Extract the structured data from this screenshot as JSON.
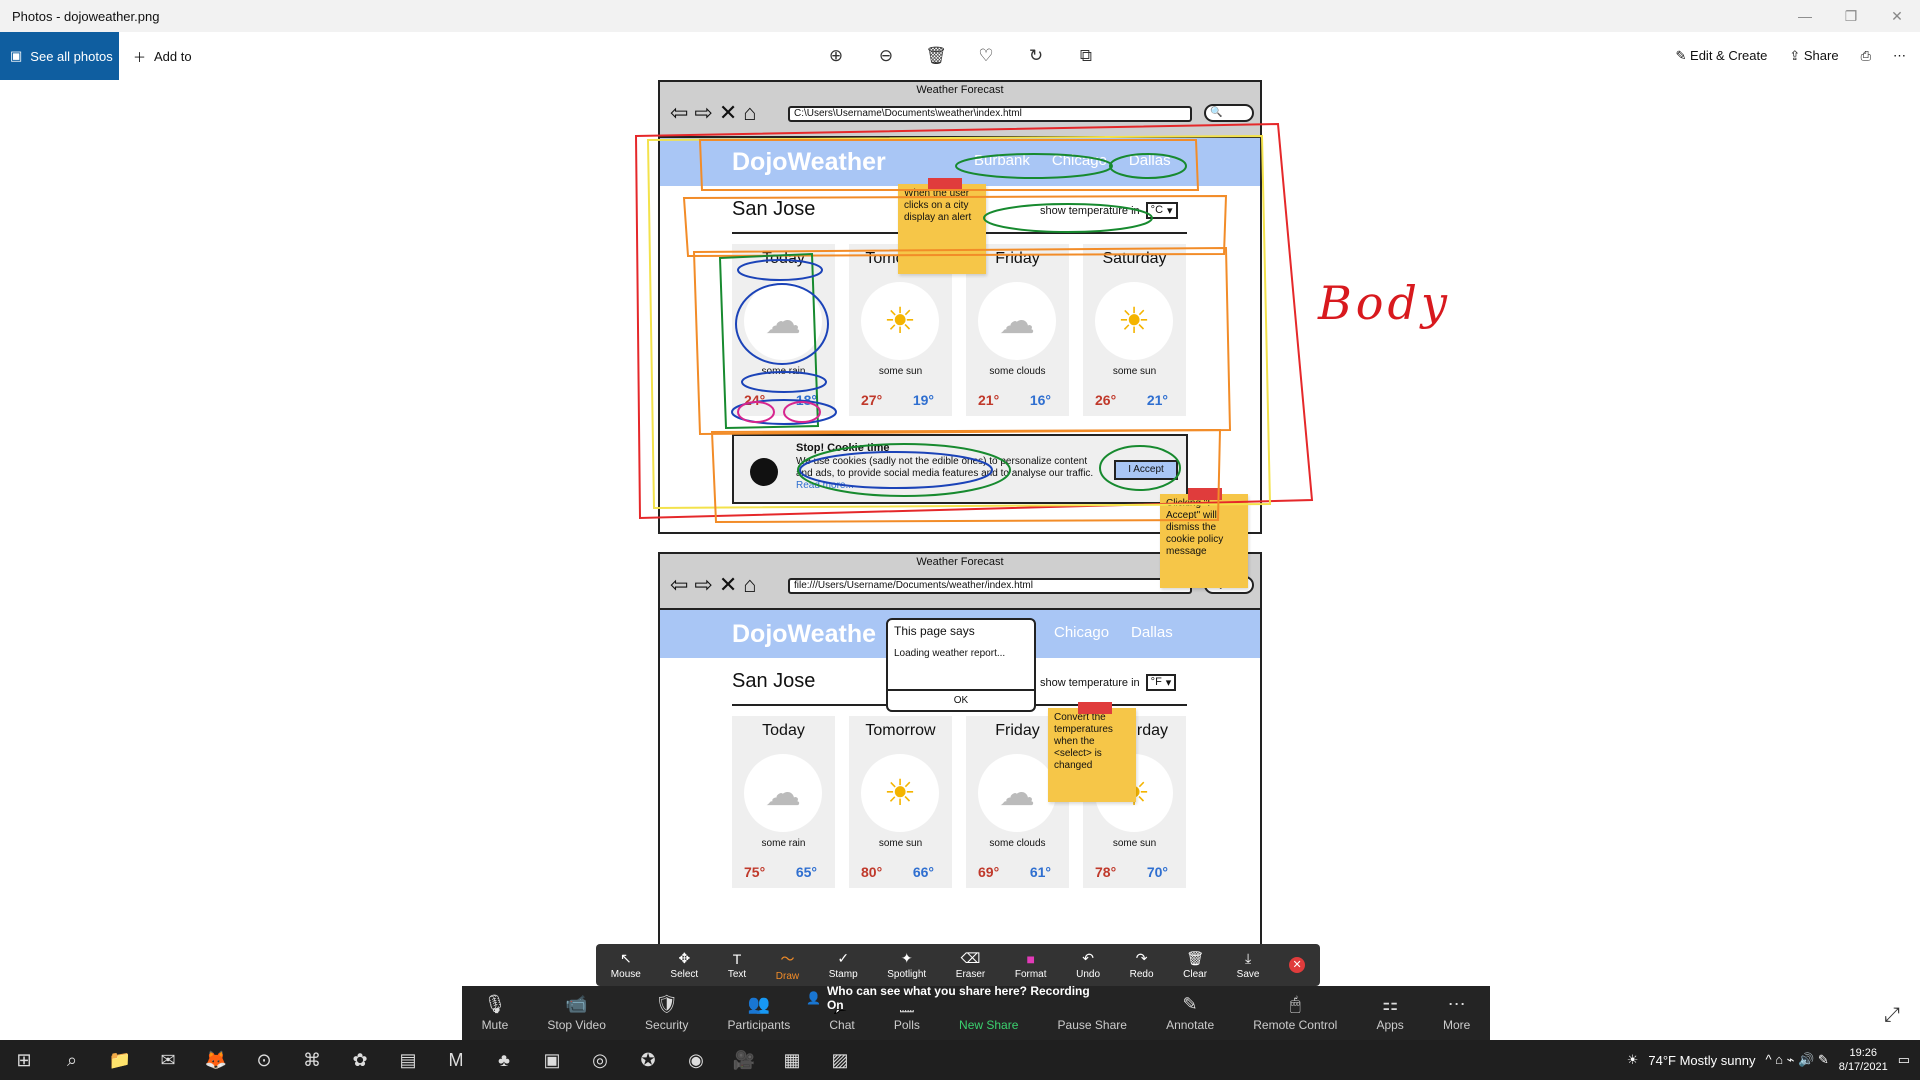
{
  "window": {
    "title": "Photos - dojoweather.png",
    "minimize": "—",
    "restore": "❐",
    "close": "✕"
  },
  "toolbar": {
    "see_all": "See all photos",
    "add_to": "Add to",
    "icons": [
      "zoom-in-icon",
      "zoom-out-icon",
      "delete-icon",
      "favorite-icon",
      "rotate-icon",
      "crop-icon"
    ],
    "glyphs": {
      "zoom_in": "⊕",
      "zoom_out": "⊖",
      "delete": "🗑",
      "favorite": "♡",
      "rotate": "↻",
      "crop": "⧉",
      "edit": "✎",
      "share": "⇪",
      "print": "⎙",
      "more": "⋯",
      "plus": "＋",
      "photos": "▣"
    },
    "edit_create": "Edit & Create",
    "share": "Share"
  },
  "wireframe_top": {
    "window_title": "Weather Forecast",
    "nav_glyphs": "⇦⇨✕⌂",
    "url": "C:\\Users\\Username\\Documents\\weather\\index.html",
    "search_glyph": "🔍",
    "logo": "DojoWeather",
    "cities": [
      "Burbank",
      "Chicago",
      "Dallas"
    ],
    "city": "San Jose",
    "show_temp_label": "show temperature in",
    "unit": "°C",
    "unit_arrow": "▾",
    "days": [
      {
        "day": "Today",
        "icon": "☁",
        "desc": "some rain",
        "hi": "24°",
        "lo": "18°"
      },
      {
        "day": "Tomorrow",
        "icon": "☀",
        "desc": "some sun",
        "hi": "27°",
        "lo": "19°"
      },
      {
        "day": "Friday",
        "icon": "☁",
        "desc": "some clouds",
        "hi": "21°",
        "lo": "16°"
      },
      {
        "day": "Saturday",
        "icon": "☀",
        "desc": "some sun",
        "hi": "26°",
        "lo": "21°"
      }
    ],
    "cookie": {
      "title": "Stop! Cookie time",
      "message": "We use cookies (sadly not the edible ones) to personalize content and ads, to provide social media features and to analyse our traffic.",
      "read_more": "Read more...",
      "accept": "I Accept"
    }
  },
  "wireframe_bottom": {
    "window_title": "Weather Forecast",
    "nav_glyphs": "⇦⇨✕⌂",
    "url": "file:///Users/Username/Documents/weather/index.html",
    "search_glyph": "🔍",
    "logo": "DojoWeathe",
    "cities": [
      "Chicago",
      "Dallas"
    ],
    "city": "San Jose",
    "show_temp_label": "show temperature in",
    "unit": "°F",
    "unit_arrow": "▾",
    "days": [
      {
        "day": "Today",
        "icon": "☁",
        "desc": "some rain",
        "hi": "75°",
        "lo": "65°"
      },
      {
        "day": "Tomorrow",
        "icon": "☀",
        "desc": "some sun",
        "hi": "80°",
        "lo": "66°"
      },
      {
        "day": "Friday",
        "icon": "☁",
        "desc": "some clouds",
        "hi": "69°",
        "lo": "61°"
      },
      {
        "day": "rday",
        "icon": "☀",
        "desc": "some sun",
        "hi": "78°",
        "lo": "70°"
      }
    ],
    "alert": {
      "title": "This page says",
      "message": "Loading weather report...",
      "ok": "OK"
    }
  },
  "stickies": {
    "city_alert": "When the user clicks on a city display an alert",
    "accept_note": "Clicking \"I Accept\" will dismiss the cookie policy message",
    "convert_note": "Convert the temperatures when the <select> is changed"
  },
  "handwriting": {
    "body_label": "Body"
  },
  "annotate_bar": [
    {
      "label": "Mouse",
      "icon": "↖"
    },
    {
      "label": "Select",
      "icon": "✥"
    },
    {
      "label": "Text",
      "icon": "T"
    },
    {
      "label": "Draw",
      "icon": "〜"
    },
    {
      "label": "Stamp",
      "icon": "✓"
    },
    {
      "label": "Spotlight",
      "icon": "✦"
    },
    {
      "label": "Eraser",
      "icon": "⌫"
    },
    {
      "label": "Format",
      "icon": "■"
    },
    {
      "label": "Undo",
      "icon": "↶"
    },
    {
      "label": "Redo",
      "icon": "↷"
    },
    {
      "label": "Clear",
      "icon": "🗑"
    },
    {
      "label": "Save",
      "icon": "⤓"
    }
  ],
  "annotate_close": "✕",
  "zoom_bar": {
    "banner": "Who can see what you share here? Recording On",
    "banner_icon": "👤",
    "buttons": [
      {
        "label": "Mute",
        "icon": "🎙"
      },
      {
        "label": "Stop Video",
        "icon": "📹"
      },
      {
        "label": "Security",
        "icon": "🛡"
      },
      {
        "label": "Participants",
        "icon": "👥"
      },
      {
        "label": "Chat",
        "icon": "💬"
      },
      {
        "label": "Polls",
        "icon": "▦"
      },
      {
        "label": "New Share",
        "icon": "⬆"
      },
      {
        "label": "Pause Share",
        "icon": "⏸"
      },
      {
        "label": "Annotate",
        "icon": "✎"
      },
      {
        "label": "Remote Control",
        "icon": "🖱"
      },
      {
        "label": "Apps",
        "icon": "⚏"
      },
      {
        "label": "More",
        "icon": "⋯"
      }
    ]
  },
  "expand_icon": "⤢",
  "taskbar": {
    "start": "⊞",
    "search": "⌕",
    "apps": [
      "📁",
      "✉",
      "🦊",
      "⊙",
      "⌘",
      "✿",
      "▤",
      "M",
      "♣",
      "▣",
      "◎",
      "✪",
      "◉",
      "🎥",
      "▦",
      "▨"
    ],
    "weather": "74°F  Mostly sunny",
    "weather_icon": "☀",
    "tray_icons": "^ ⌂ ⌁ 🔊 ✎",
    "time": "19:26",
    "date": "8/17/2021",
    "notif": "▭"
  }
}
